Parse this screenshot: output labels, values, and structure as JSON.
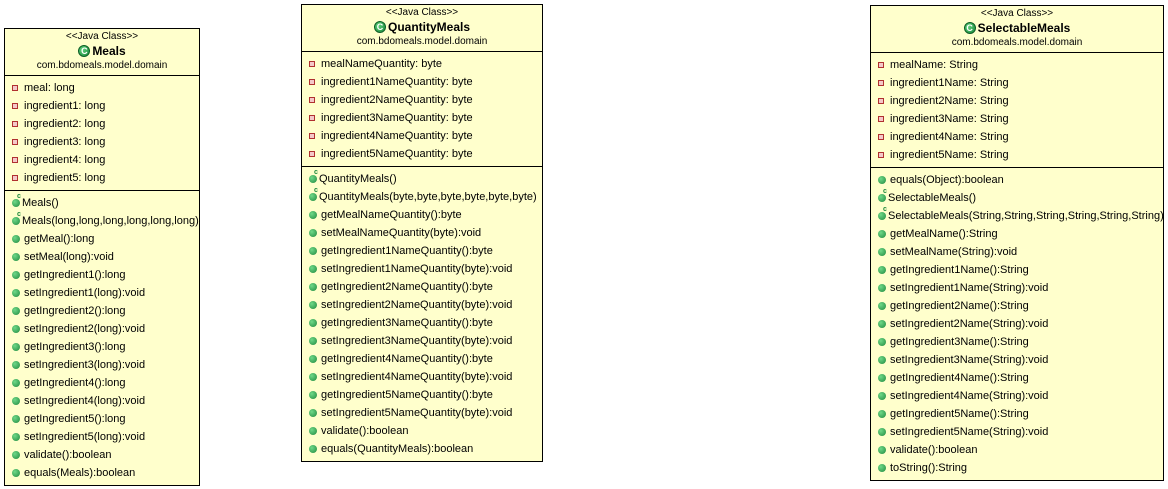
{
  "classes": [
    {
      "stereotype": "<<Java Class>>",
      "name": "Meals",
      "package": "com.bdomeals.model.domain",
      "attributes": [
        "meal: long",
        "ingredient1: long",
        "ingredient2: long",
        "ingredient3: long",
        "ingredient4: long",
        "ingredient5: long"
      ],
      "operations": [
        {
          "text": "Meals()",
          "kind": "constructor"
        },
        {
          "text": "Meals(long,long,long,long,long,long)",
          "kind": "constructor"
        },
        {
          "text": "getMeal():long",
          "kind": "method"
        },
        {
          "text": "setMeal(long):void",
          "kind": "method"
        },
        {
          "text": "getIngredient1():long",
          "kind": "method"
        },
        {
          "text": "setIngredient1(long):void",
          "kind": "method"
        },
        {
          "text": "getIngredient2():long",
          "kind": "method"
        },
        {
          "text": "setIngredient2(long):void",
          "kind": "method"
        },
        {
          "text": "getIngredient3():long",
          "kind": "method"
        },
        {
          "text": "setIngredient3(long):void",
          "kind": "method"
        },
        {
          "text": "getIngredient4():long",
          "kind": "method"
        },
        {
          "text": "setIngredient4(long):void",
          "kind": "method"
        },
        {
          "text": "getIngredient5():long",
          "kind": "method"
        },
        {
          "text": "setIngredient5(long):void",
          "kind": "method"
        },
        {
          "text": "validate():boolean",
          "kind": "method"
        },
        {
          "text": "equals(Meals):boolean",
          "kind": "method"
        }
      ]
    },
    {
      "stereotype": "<<Java Class>>",
      "name": "QuantityMeals",
      "package": "com.bdomeals.model.domain",
      "attributes": [
        "mealNameQuantity: byte",
        "ingredient1NameQuantity: byte",
        "ingredient2NameQuantity: byte",
        "ingredient3NameQuantity: byte",
        "ingredient4NameQuantity: byte",
        "ingredient5NameQuantity: byte"
      ],
      "operations": [
        {
          "text": "QuantityMeals()",
          "kind": "constructor"
        },
        {
          "text": "QuantityMeals(byte,byte,byte,byte,byte,byte)",
          "kind": "constructor"
        },
        {
          "text": "getMealNameQuantity():byte",
          "kind": "method"
        },
        {
          "text": "setMealNameQuantity(byte):void",
          "kind": "method"
        },
        {
          "text": "getIngredient1NameQuantity():byte",
          "kind": "method"
        },
        {
          "text": "setIngredient1NameQuantity(byte):void",
          "kind": "method"
        },
        {
          "text": "getIngredient2NameQuantity():byte",
          "kind": "method"
        },
        {
          "text": "setIngredient2NameQuantity(byte):void",
          "kind": "method"
        },
        {
          "text": "getIngredient3NameQuantity():byte",
          "kind": "method"
        },
        {
          "text": "setIngredient3NameQuantity(byte):void",
          "kind": "method"
        },
        {
          "text": "getIngredient4NameQuantity():byte",
          "kind": "method"
        },
        {
          "text": "setIngredient4NameQuantity(byte):void",
          "kind": "method"
        },
        {
          "text": "getIngredient5NameQuantity():byte",
          "kind": "method"
        },
        {
          "text": "setIngredient5NameQuantity(byte):void",
          "kind": "method"
        },
        {
          "text": "validate():boolean",
          "kind": "method"
        },
        {
          "text": "equals(QuantityMeals):boolean",
          "kind": "method"
        }
      ]
    },
    {
      "stereotype": "<<Java Class>>",
      "name": "SelectableMeals",
      "package": "com.bdomeals.model.domain",
      "attributes": [
        "mealName: String",
        "ingredient1Name: String",
        "ingredient2Name: String",
        "ingredient3Name: String",
        "ingredient4Name: String",
        "ingredient5Name: String"
      ],
      "operations": [
        {
          "text": "equals(Object):boolean",
          "kind": "method"
        },
        {
          "text": "SelectableMeals()",
          "kind": "constructor"
        },
        {
          "text": "SelectableMeals(String,String,String,String,String,String)",
          "kind": "constructor"
        },
        {
          "text": "getMealName():String",
          "kind": "method"
        },
        {
          "text": "setMealName(String):void",
          "kind": "method"
        },
        {
          "text": "getIngredient1Name():String",
          "kind": "method"
        },
        {
          "text": "setIngredient1Name(String):void",
          "kind": "method"
        },
        {
          "text": "getIngredient2Name():String",
          "kind": "method"
        },
        {
          "text": "setIngredient2Name(String):void",
          "kind": "method"
        },
        {
          "text": "getIngredient3Name():String",
          "kind": "method"
        },
        {
          "text": "setIngredient3Name(String):void",
          "kind": "method"
        },
        {
          "text": "getIngredient4Name():String",
          "kind": "method"
        },
        {
          "text": "setIngredient4Name(String):void",
          "kind": "method"
        },
        {
          "text": "getIngredient5Name():String",
          "kind": "method"
        },
        {
          "text": "setIngredient5Name(String):void",
          "kind": "method"
        },
        {
          "text": "validate():boolean",
          "kind": "method"
        },
        {
          "text": "toString():String",
          "kind": "method"
        }
      ]
    }
  ],
  "icons": {
    "class": "class-icon",
    "attribute": "private-field-icon",
    "method": "public-method-icon",
    "constructor": "constructor-icon"
  },
  "colors": {
    "class_fill": "#ffffcc",
    "border": "#000000",
    "class_icon": "#17883a",
    "field_icon": "#b03030"
  }
}
